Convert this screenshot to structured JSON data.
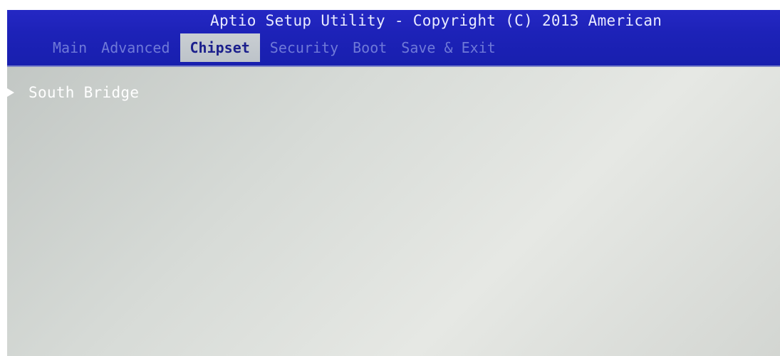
{
  "header": {
    "title": "Aptio Setup Utility - Copyright (C) 2013 American",
    "colors": {
      "background": "#1d22b8",
      "title_text": "#e8eaff",
      "inactive_tab": "#6f79d8",
      "active_tab_bg": "#c4c9ce",
      "active_tab_text": "#1b1f8c"
    }
  },
  "tabs": [
    {
      "label": "Main",
      "active": false
    },
    {
      "label": "Advanced",
      "active": false
    },
    {
      "label": "Chipset",
      "active": true
    },
    {
      "label": "Security",
      "active": false
    },
    {
      "label": "Boot",
      "active": false
    },
    {
      "label": "Save & Exit",
      "active": false
    }
  ],
  "content": {
    "items": [
      {
        "label": "South Bridge",
        "icon": "submenu-arrow-icon"
      }
    ],
    "colors": {
      "background": "#d7dbd7",
      "item_text": "#ffffff"
    }
  }
}
